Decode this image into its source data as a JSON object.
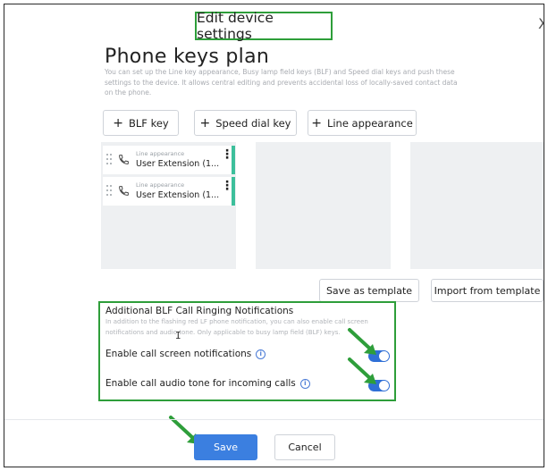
{
  "dialog": {
    "title": "Edit device settings",
    "close_glyph": "X"
  },
  "page": {
    "title": "Phone keys plan",
    "description": "You can set up the Line key appearance, Busy lamp field keys (BLF) and Speed dial keys and push these settings to the device. It allows central editing and prevents accidental loss of locally-saved contact data on the phone."
  },
  "add_buttons": {
    "blf": "BLF key",
    "speed_dial": "Speed dial key",
    "line_appearance": "Line appearance"
  },
  "keys": [
    {
      "type": "Line appearance",
      "name": "User Extension (1...",
      "icon": "phone-icon"
    },
    {
      "type": "Line appearance",
      "name": "User Extension (1...",
      "icon": "phone-icon"
    }
  ],
  "actions": {
    "save_template": "Save as template",
    "import_template": "Import from template"
  },
  "blf_notifications": {
    "title": "Additional BLF Call Ringing Notifications",
    "description": "In addition to the flashing red LF phone notification, you can also enable call screen notifications and audio tone. Only applicable to busy lamp field (BLF) keys.",
    "settings": [
      {
        "label": "Enable call screen notifications",
        "enabled": true
      },
      {
        "label": "Enable call audio tone for incoming calls",
        "enabled": true
      }
    ]
  },
  "footer": {
    "save": "Save",
    "cancel": "Cancel"
  },
  "colors": {
    "highlight_green": "#2e9e3a",
    "toggle_blue": "#2f6fd6",
    "save_blue": "#3b7fe0",
    "key_accent": "#3cbf9b"
  }
}
